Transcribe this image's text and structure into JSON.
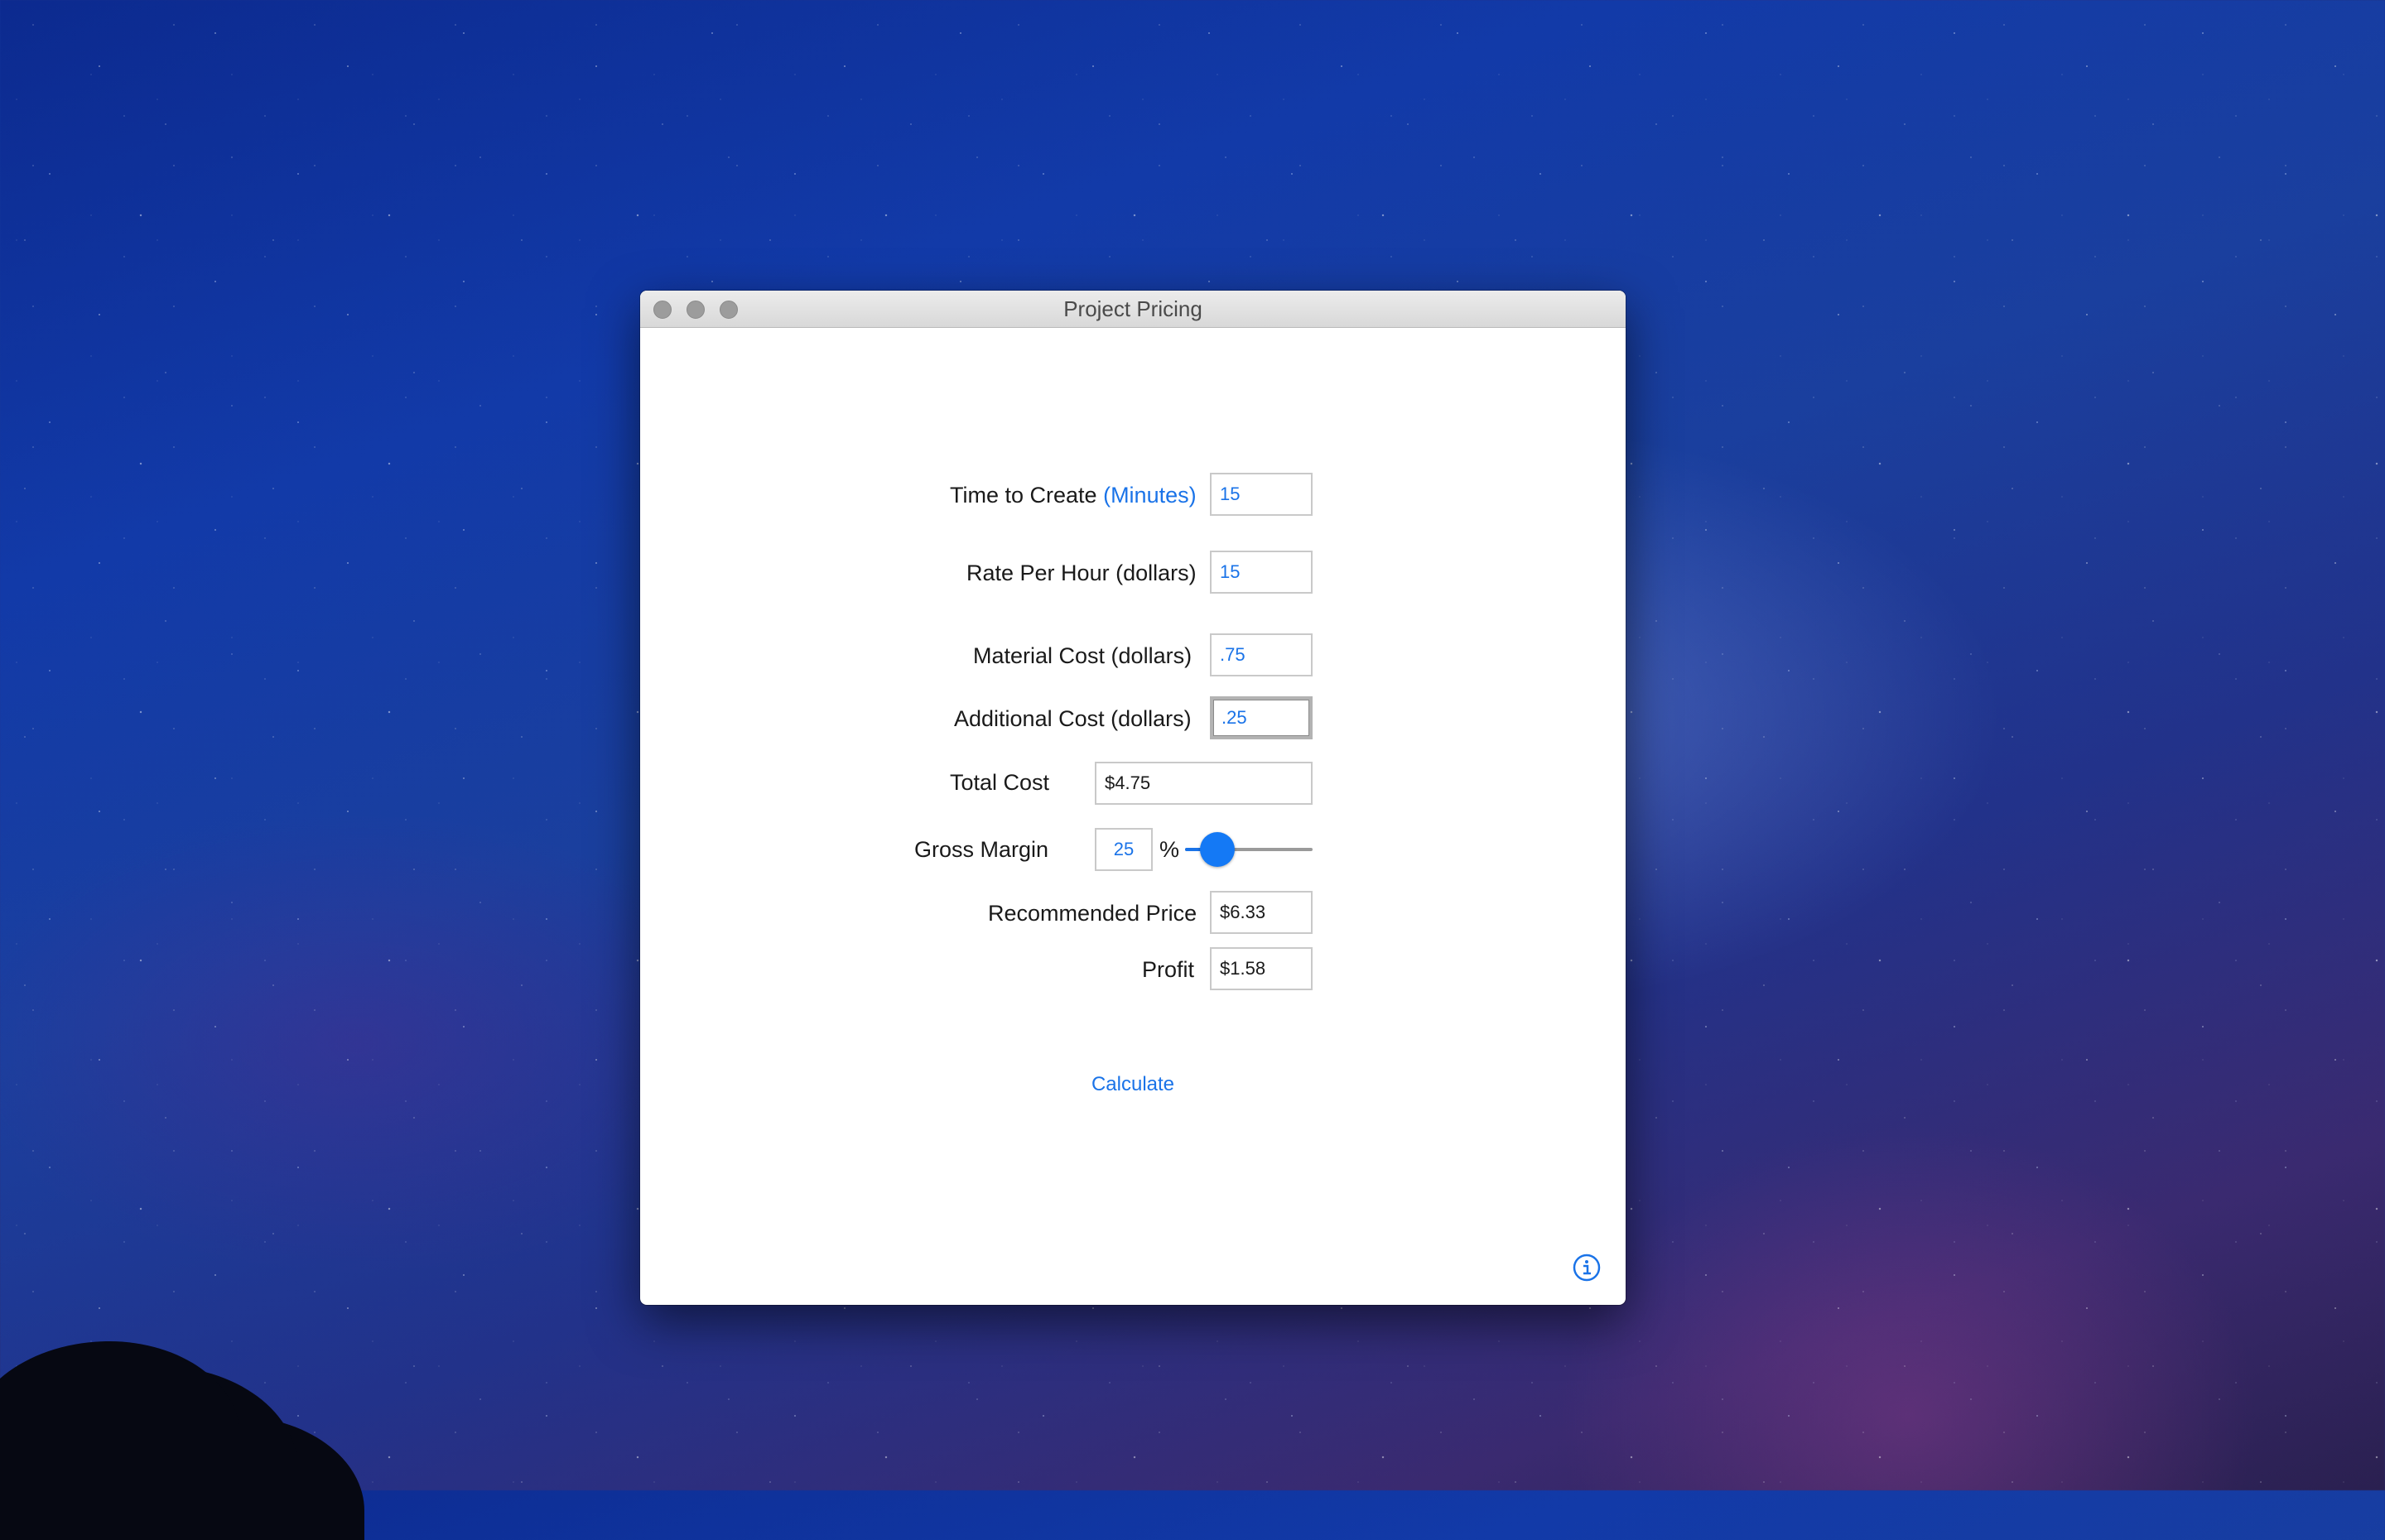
{
  "window": {
    "title": "Project Pricing"
  },
  "form": {
    "time_label": "Time to Create",
    "time_unit": "(Minutes)",
    "time_value": "15",
    "rate_label": "Rate Per Hour (dollars)",
    "rate_value": "15",
    "material_label": "Material Cost (dollars)",
    "material_value": ".75",
    "additional_label": "Additional Cost (dollars)",
    "additional_value": ".25",
    "total_label": "Total Cost",
    "total_value": "$4.75",
    "margin_label": "Gross Margin",
    "margin_value": "25",
    "margin_percent_sign": "%",
    "margin_slider_fraction": 0.25,
    "price_label": "Recommended Price",
    "price_value": "$6.33",
    "profit_label": "Profit",
    "profit_value": "$1.58",
    "calculate_label": "Calculate"
  },
  "icons": {
    "info": "info-icon"
  },
  "colors": {
    "accent": "#1a73e8",
    "slider_thumb": "#1479f5"
  }
}
